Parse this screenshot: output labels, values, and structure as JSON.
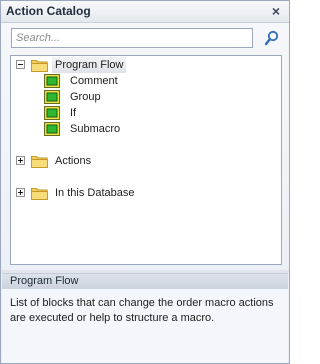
{
  "pane": {
    "title": "Action Catalog",
    "close_icon": "×"
  },
  "search": {
    "placeholder": "Search...",
    "value": ""
  },
  "tree": {
    "program_flow": {
      "label": "Program Flow",
      "children": [
        "Comment",
        "Group",
        "If",
        "Submacro"
      ]
    },
    "actions": {
      "label": "Actions"
    },
    "database": {
      "label": "In this Database"
    }
  },
  "description": {
    "title": "Program Flow",
    "text": "List of blocks that can change the order macro actions are executed or help to structure a macro."
  },
  "icons": [
    "close-icon",
    "search-icon",
    "folder-icon",
    "macro-block-icon",
    "expand-icon",
    "collapse-icon"
  ],
  "colors": {
    "block_green": "#2fb82f",
    "folder_yellow": "#f2cd5a",
    "border": "#9aa7bc"
  }
}
